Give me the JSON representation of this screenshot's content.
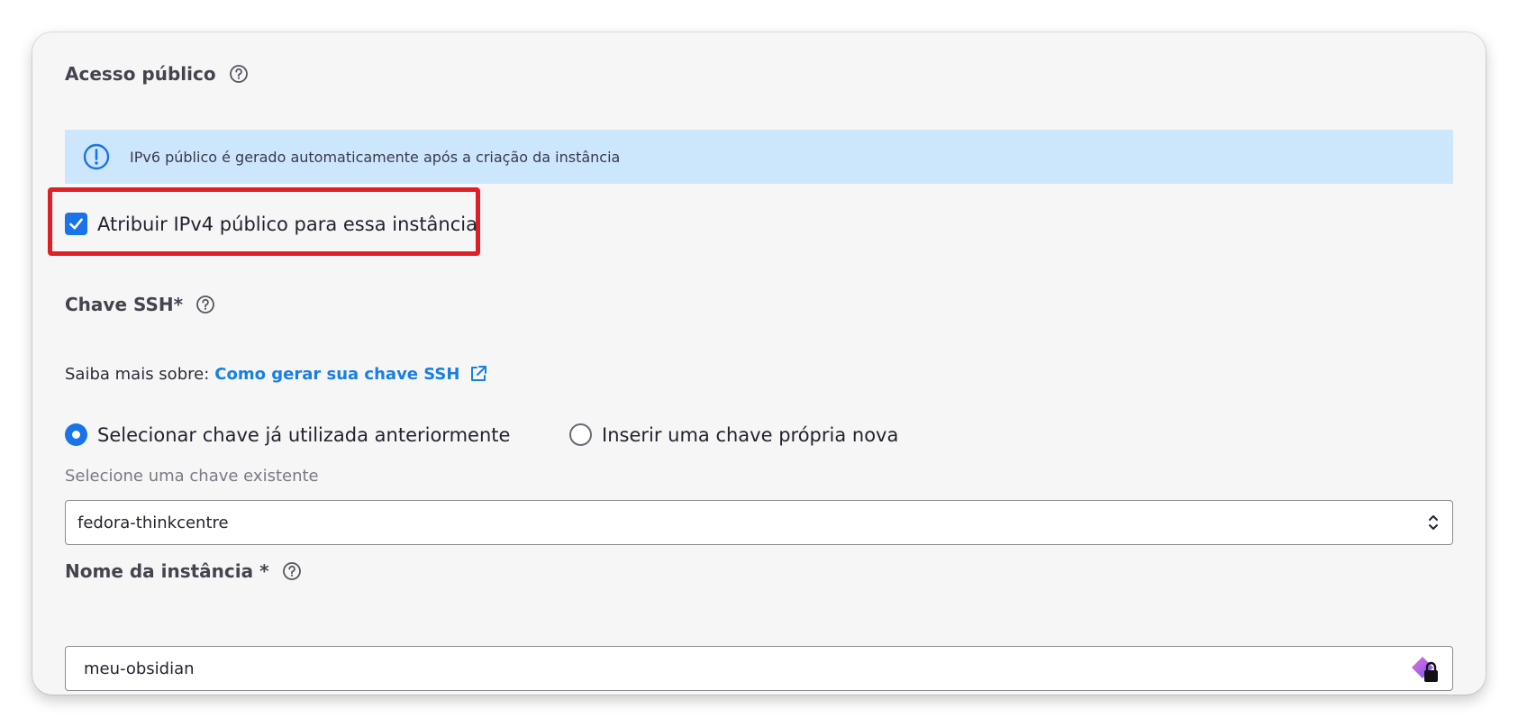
{
  "public_access": {
    "title": "Acesso público",
    "info_text": "IPv6 público é gerado automaticamente após a criação da instância",
    "ipv4_checkbox_label": "Atribuir IPv4 público para essa instância",
    "ipv4_checked": true
  },
  "ssh": {
    "title": "Chave SSH*",
    "learn_more_prefix": "Saiba mais sobre:",
    "learn_more_link": "Como gerar sua chave SSH",
    "radio_existing_label": "Selecionar chave já utilizada anteriormente",
    "radio_new_label": "Inserir uma chave própria nova",
    "select_label": "Selecione uma chave existente",
    "select_value": "fedora-thinkcentre"
  },
  "instance_name": {
    "title": "Nome da instância *",
    "value": "meu-obsidian"
  },
  "colors": {
    "accent": "#1a73e8",
    "link": "#1a7fe0",
    "info_banner_bg": "#cce6fc",
    "highlight": "#e01e25"
  },
  "icons": {
    "help": "help-circle-icon",
    "info": "info-circle-icon",
    "external_link": "external-link-icon",
    "select_arrows": "chevron-up-down-icon",
    "password_manager": "password-manager-lock-icon"
  }
}
